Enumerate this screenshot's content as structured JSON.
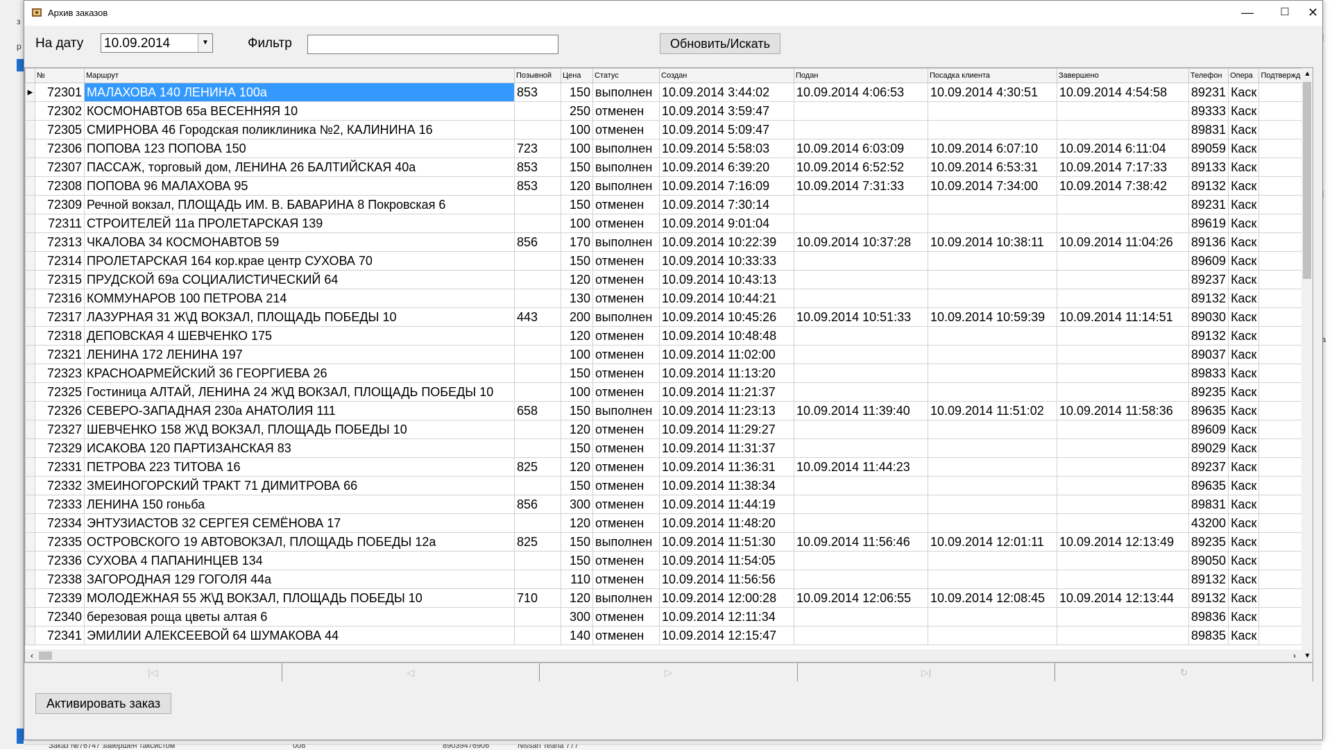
{
  "window": {
    "title": "Архив заказов"
  },
  "toolbar": {
    "date_label": "На дату",
    "date_value": "10.09.2014",
    "filter_label": "Фильтр",
    "filter_value": "",
    "refresh_button": "Обновить/Искать"
  },
  "grid": {
    "columns": [
      "№",
      "Маршрут",
      "Позывной",
      "Цена",
      "Статус",
      "Создан",
      "Подан",
      "Посадка клиента",
      "Завершено",
      "Телефон",
      "Опера",
      "Подтвержд"
    ],
    "rows": [
      [
        "72301",
        "МАЛАХОВА 140 ЛЕНИНА 100а",
        "853",
        "150",
        "выполнен",
        "10.09.2014 3:44:02",
        "10.09.2014 4:06:53",
        "10.09.2014 4:30:51",
        "10.09.2014 4:54:58",
        "89231",
        "Каск",
        ""
      ],
      [
        "72302",
        "КОСМОНАВТОВ 65а ВЕСЕННЯЯ 10",
        "",
        "250",
        "отменен",
        "10.09.2014 3:59:47",
        "",
        "",
        "",
        "89333",
        "Каск",
        ""
      ],
      [
        "72305",
        "СМИРНОВА 46 Городская поликлиника №2, КАЛИНИНА 16",
        "",
        "100",
        "отменен",
        "10.09.2014 5:09:47",
        "",
        "",
        "",
        "89831",
        "Каск",
        ""
      ],
      [
        "72306",
        "ПОПОВА 123 ПОПОВА 150",
        "723",
        "100",
        "выполнен",
        "10.09.2014 5:58:03",
        "10.09.2014 6:03:09",
        "10.09.2014 6:07:10",
        "10.09.2014 6:11:04",
        "89059",
        "Каск",
        ""
      ],
      [
        "72307",
        "ПАССАЖ, торговый дом, ЛЕНИНА 26 БАЛТИЙСКАЯ 40а",
        "853",
        "150",
        "выполнен",
        "10.09.2014 6:39:20",
        "10.09.2014 6:52:52",
        "10.09.2014 6:53:31",
        "10.09.2014 7:17:33",
        "89133",
        "Каск",
        ""
      ],
      [
        "72308",
        "ПОПОВА 96 МАЛАХОВА 95",
        "853",
        "120",
        "выполнен",
        "10.09.2014 7:16:09",
        "10.09.2014 7:31:33",
        "10.09.2014 7:34:00",
        "10.09.2014 7:38:42",
        "89132",
        "Каск",
        ""
      ],
      [
        "72309",
        "Речной вокзал, ПЛОЩАДЬ ИМ. В. БАВАРИНА 8 Покровская 6",
        "",
        "150",
        "отменен",
        "10.09.2014 7:30:14",
        "",
        "",
        "",
        "89231",
        "Каск",
        ""
      ],
      [
        "72311",
        "СТРОИТЕЛЕЙ 11а ПРОЛЕТАРСКАЯ 139",
        "",
        "100",
        "отменен",
        "10.09.2014 9:01:04",
        "",
        "",
        "",
        "89619",
        "Каск",
        ""
      ],
      [
        "72313",
        "ЧКАЛОВА 34 КОСМОНАВТОВ 59",
        "856",
        "170",
        "выполнен",
        "10.09.2014 10:22:39",
        "10.09.2014 10:37:28",
        "10.09.2014 10:38:11",
        "10.09.2014 11:04:26",
        "89136",
        "Каск",
        ""
      ],
      [
        "72314",
        "ПРОЛЕТАРСКАЯ 164 кор.крае центр  СУХОВА 70",
        "",
        "150",
        "отменен",
        "10.09.2014 10:33:33",
        "",
        "",
        "",
        "89609",
        "Каск",
        ""
      ],
      [
        "72315",
        "ПРУДСКОЙ 69а СОЦИАЛИСТИЧЕСКИЙ 64",
        "",
        "120",
        "отменен",
        "10.09.2014 10:43:13",
        "",
        "",
        "",
        "89237",
        "Каск",
        ""
      ],
      [
        "72316",
        "КОММУНАРОВ 100 ПЕТРОВА 214",
        "",
        "130",
        "отменен",
        "10.09.2014 10:44:21",
        "",
        "",
        "",
        "89132",
        "Каск",
        ""
      ],
      [
        "72317",
        "ЛАЗУРНАЯ 31 Ж\\Д ВОКЗАЛ, ПЛОЩАДЬ ПОБЕДЫ 10",
        "443",
        "200",
        "выполнен",
        "10.09.2014 10:45:26",
        "10.09.2014 10:51:33",
        "10.09.2014 10:59:39",
        "10.09.2014 11:14:51",
        "89030",
        "Каск",
        ""
      ],
      [
        "72318",
        "ДЕПОВСКАЯ 4 ШЕВЧЕНКО 175",
        "",
        "120",
        "отменен",
        "10.09.2014 10:48:48",
        "",
        "",
        "",
        "89132",
        "Каск",
        ""
      ],
      [
        "72321",
        "ЛЕНИНА 172 ЛЕНИНА 197",
        "",
        "100",
        "отменен",
        "10.09.2014 11:02:00",
        "",
        "",
        "",
        "89037",
        "Каск",
        ""
      ],
      [
        "72323",
        "КРАСНОАРМЕЙСКИЙ 36 ГЕОРГИЕВА 26",
        "",
        "150",
        "отменен",
        "10.09.2014 11:13:20",
        "",
        "",
        "",
        "89833",
        "Каск",
        ""
      ],
      [
        "72325",
        "Гостиница АЛТАЙ, ЛЕНИНА 24 Ж\\Д ВОКЗАЛ, ПЛОЩАДЬ ПОБЕДЫ 10",
        "",
        "100",
        "отменен",
        "10.09.2014 11:21:37",
        "",
        "",
        "",
        "89235",
        "Каск",
        ""
      ],
      [
        "72326",
        "СЕВЕРО-ЗАПАДНАЯ 230а АНАТОЛИЯ 111",
        "658",
        "150",
        "выполнен",
        "10.09.2014 11:23:13",
        "10.09.2014 11:39:40",
        "10.09.2014 11:51:02",
        "10.09.2014 11:58:36",
        "89635",
        "Каск",
        ""
      ],
      [
        "72327",
        "ШЕВЧЕНКО 158 Ж\\Д ВОКЗАЛ, ПЛОЩАДЬ ПОБЕДЫ 10",
        "",
        "120",
        "отменен",
        "10.09.2014 11:29:27",
        "",
        "",
        "",
        "89609",
        "Каск",
        ""
      ],
      [
        "72329",
        "ИСАКОВА 120 ПАРТИЗАНСКАЯ 83",
        "",
        "150",
        "отменен",
        "10.09.2014 11:31:37",
        "",
        "",
        "",
        "89029",
        "Каск",
        ""
      ],
      [
        "72331",
        "ПЕТРОВА 223 ТИТОВА 16",
        "825",
        "120",
        "отменен",
        "10.09.2014 11:36:31",
        "10.09.2014 11:44:23",
        "",
        "",
        "89237",
        "Каск",
        ""
      ],
      [
        "72332",
        "ЗМЕИНОГОРСКИЙ ТРАКТ 71 ДИМИТРОВА 66",
        "",
        "150",
        "отменен",
        "10.09.2014 11:38:34",
        "",
        "",
        "",
        "89635",
        "Каск",
        ""
      ],
      [
        "72333",
        "ЛЕНИНА 150 гоньба",
        "856",
        "300",
        "отменен",
        "10.09.2014 11:44:19",
        "",
        "",
        "",
        "89831",
        "Каск",
        ""
      ],
      [
        "72334",
        "ЭНТУЗИАСТОВ 32 СЕРГЕЯ СЕМЁНОВА 17",
        "",
        "120",
        "отменен",
        "10.09.2014 11:48:20",
        "",
        "",
        "",
        "43200",
        "Каск",
        ""
      ],
      [
        "72335",
        "ОСТРОВСКОГО 19 АВТОВОКЗАЛ, ПЛОЩАДЬ ПОБЕДЫ 12а",
        "825",
        "150",
        "выполнен",
        "10.09.2014 11:51:30",
        "10.09.2014 11:56:46",
        "10.09.2014 12:01:11",
        "10.09.2014 12:13:49",
        "89235",
        "Каск",
        ""
      ],
      [
        "72336",
        "СУХОВА 4 ПАПАНИНЦЕВ 134",
        "",
        "150",
        "отменен",
        "10.09.2014 11:54:05",
        "",
        "",
        "",
        "89050",
        "Каск",
        ""
      ],
      [
        "72338",
        "ЗАГОРОДНАЯ 129 ГОГОЛЯ 44а",
        "",
        "110",
        "отменен",
        "10.09.2014 11:56:56",
        "",
        "",
        "",
        "89132",
        "Каск",
        ""
      ],
      [
        "72339",
        "МОЛОДЕЖНАЯ 55 Ж\\Д ВОКЗАЛ, ПЛОЩАДЬ ПОБЕДЫ 10",
        "710",
        "120",
        "выполнен",
        "10.09.2014 12:00:28",
        "10.09.2014 12:06:55",
        "10.09.2014 12:08:45",
        "10.09.2014 12:13:44",
        "89132",
        "Каск",
        ""
      ],
      [
        "72340",
        "березовая роща цветы алтая 6",
        "",
        "300",
        "отменен",
        "10.09.2014 12:11:34",
        "",
        "",
        "",
        "89836",
        "Каск",
        ""
      ],
      [
        "72341",
        "ЭМИЛИИ АЛЕКСЕЕВОЙ 64 ШУМАКОВА 44",
        "",
        "140",
        "отменен",
        "10.09.2014 12:15:47",
        "",
        "",
        "",
        "89835",
        "Каск",
        ""
      ]
    ]
  },
  "navigator": [
    "|◁",
    "◁",
    "▷",
    "▷|",
    "↻"
  ],
  "actions": {
    "activate_button": "Активировать заказ"
  },
  "background": {
    "status_text": "Заказ №76747 завершен таксистом",
    "status_num": "008",
    "status_phone": "89039476906",
    "status_car": "Nissan Teana 777"
  },
  "colors": {
    "selection": "#3399ff"
  }
}
